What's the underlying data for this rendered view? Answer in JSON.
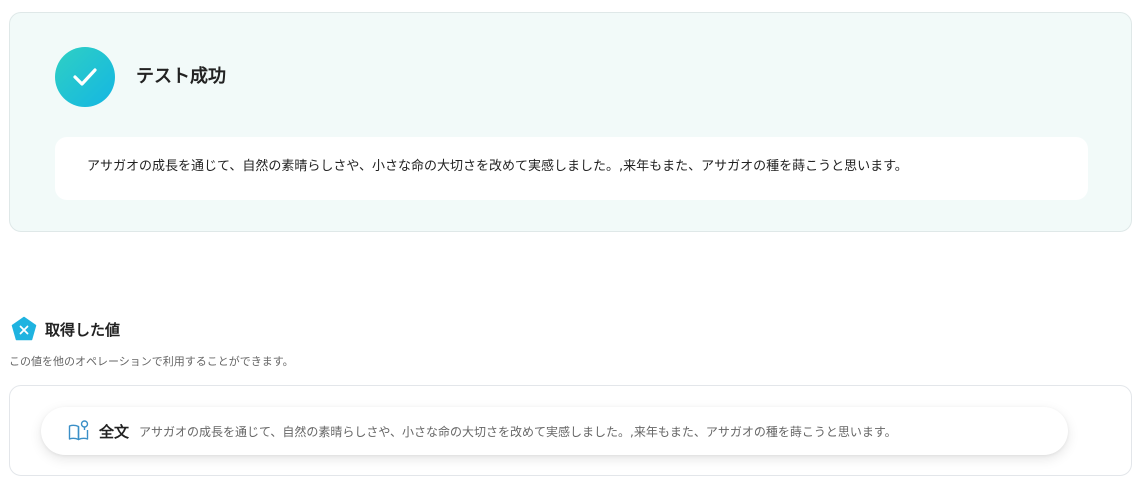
{
  "test_result": {
    "status_icon": "check-icon",
    "title": "テスト成功",
    "output_text": "アサガオの成長を通じて、自然の素晴らしさや、小さな命の大切さを改めて実感しました。,来年もまた、アサガオの種を蒔こうと思います。"
  },
  "obtained_values": {
    "icon": "pentagon-x-icon",
    "title": "取得した値",
    "description": "この値を他のオペレーションで利用することができます。",
    "items": [
      {
        "icon": "book-icon",
        "label": "全文",
        "value": "アサガオの成長を通じて、自然の素晴らしさや、小さな命の大切さを改めて実感しました。,来年もまた、アサガオの種を蒔こうと思います。"
      }
    ]
  },
  "colors": {
    "panel_bg": "#f2faf9",
    "accent_start": "#2fd0c3",
    "accent_end": "#14b6e3",
    "pentagon": "#1fb3e0"
  }
}
